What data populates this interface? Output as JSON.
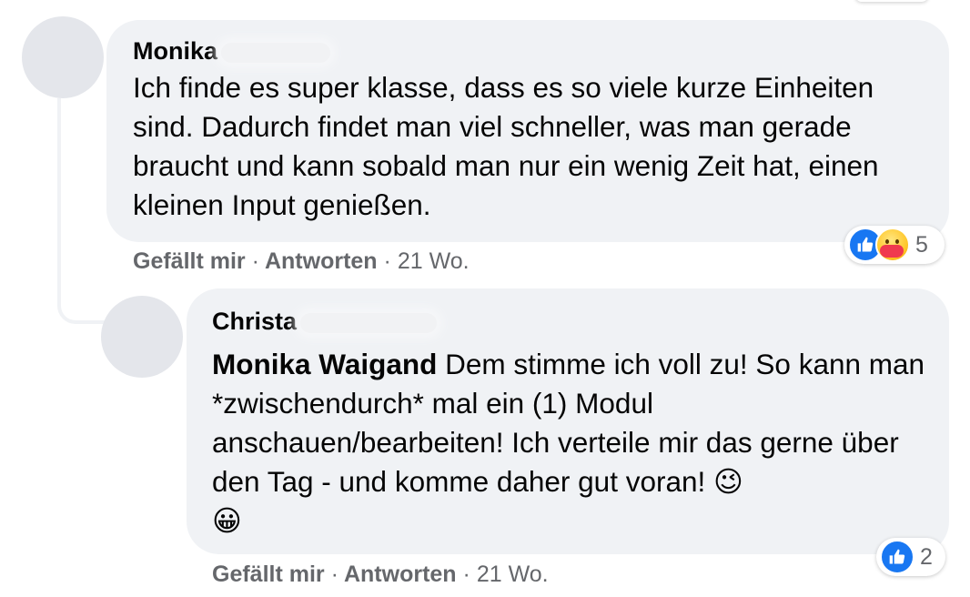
{
  "comment1": {
    "author": "Monika",
    "text": "Ich finde es super klasse, dass es so viele kurze Einheiten sind. Dadurch findet man viel schneller, was man gerade braucht und kann sobald man nur ein wenig Zeit hat, einen kleinen Input genießen.",
    "like_label": "Gefällt mir",
    "separator": "·",
    "reply_label": "Antworten",
    "time": "21 Wo.",
    "reaction_count": "5",
    "reaction_icons": [
      "like-icon",
      "care-icon"
    ],
    "like_color": "#1877f2"
  },
  "comment2": {
    "author": "Christa",
    "mention": "Monika Waigand",
    "text": "Dem stimme ich voll zu! So kann man *zwischendurch* mal ein (1) Modul anschauen/bearbeiten! Ich verteile mir das gerne über den Tag - und komme daher gut voran!",
    "emoji_wink": "😉",
    "emoji_grin": "😀",
    "like_label": "Gefällt mir",
    "separator": "·",
    "reply_label": "Antworten",
    "time": "21 Wo.",
    "reaction_count": "2",
    "reaction_icons": [
      "like-icon"
    ]
  }
}
